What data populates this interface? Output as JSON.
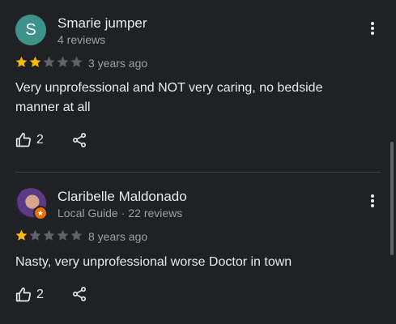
{
  "reviews": [
    {
      "avatar_letter": "S",
      "avatar_color": "#3d9389",
      "name": "Smarie jumper",
      "meta": "4 reviews",
      "rating": 2,
      "time": "3 years ago",
      "text": "Very unprofessional and NOT very caring, no bedside manner at all",
      "likes": "2"
    },
    {
      "name": "Claribelle Maldonado",
      "local_guide": "Local Guide",
      "meta": "22 reviews",
      "rating": 1,
      "time": "8 years ago",
      "text": "Nasty, very unprofessional worse Doctor in town",
      "likes": "2"
    }
  ],
  "colors": {
    "background": "#202124",
    "star_filled": "#fbbc04",
    "star_empty": "#5f6368",
    "local_guide_badge": "#e8710a"
  },
  "icons": {
    "more": "more-vert-icon",
    "like": "thumb-up-icon",
    "share": "share-icon",
    "star": "star-icon"
  }
}
